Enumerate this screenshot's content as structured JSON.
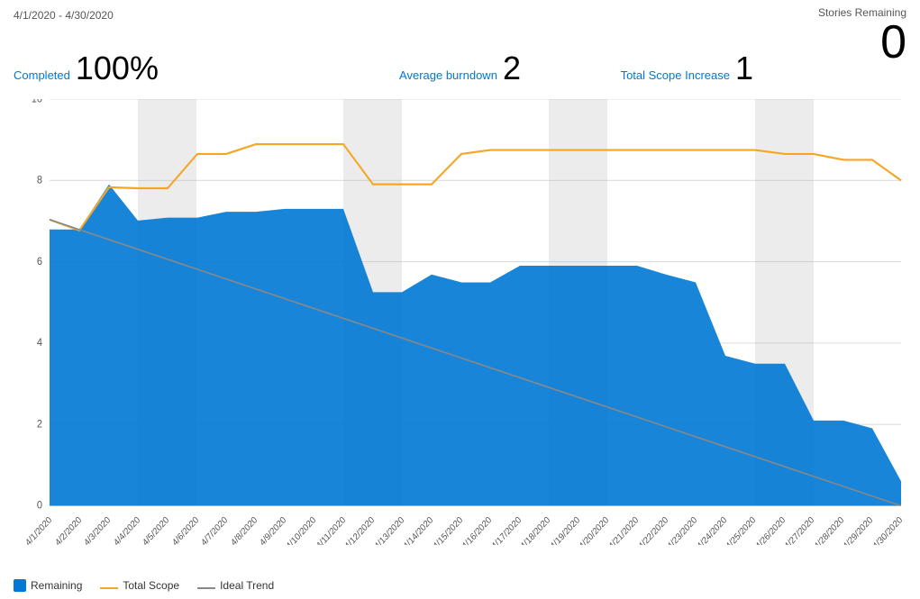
{
  "header": {
    "date_range": "4/1/2020 - 4/30/2020"
  },
  "stories_remaining": {
    "label": "Stories Remaining",
    "value": "0"
  },
  "metrics": {
    "completed": {
      "label": "Completed",
      "value": "100%"
    },
    "average_burndown": {
      "label": "Average burndown",
      "value": "2"
    },
    "total_scope_increase": {
      "label": "Total Scope Increase",
      "value": "1"
    }
  },
  "legend": {
    "remaining": "Remaining",
    "total_scope": "Total Scope",
    "ideal_trend": "Ideal Trend"
  },
  "colors": {
    "remaining_fill": "#0078d4",
    "total_scope": "#f5a623",
    "ideal_trend": "#888",
    "weekend": "rgba(180,180,180,0.3)"
  },
  "chart": {
    "y_labels": [
      "0",
      "2",
      "4",
      "6",
      "8",
      "10"
    ],
    "x_labels": [
      "4/1/2020",
      "4/2/2020",
      "4/3/2020",
      "4/4/2020",
      "4/5/2020",
      "4/6/2020",
      "4/7/2020",
      "4/8/2020",
      "4/9/2020",
      "4/10/2020",
      "4/11/2020",
      "4/12/2020",
      "4/13/2020",
      "4/14/2020",
      "4/15/2020",
      "4/16/2020",
      "4/17/2020",
      "4/18/2020",
      "4/19/2020",
      "4/20/2020",
      "4/21/2020",
      "4/22/2020",
      "4/23/2020",
      "4/24/2020",
      "4/25/2020",
      "4/26/2020",
      "4/27/2020",
      "4/28/2020",
      "4/29/2020",
      "4/30/2020"
    ]
  }
}
